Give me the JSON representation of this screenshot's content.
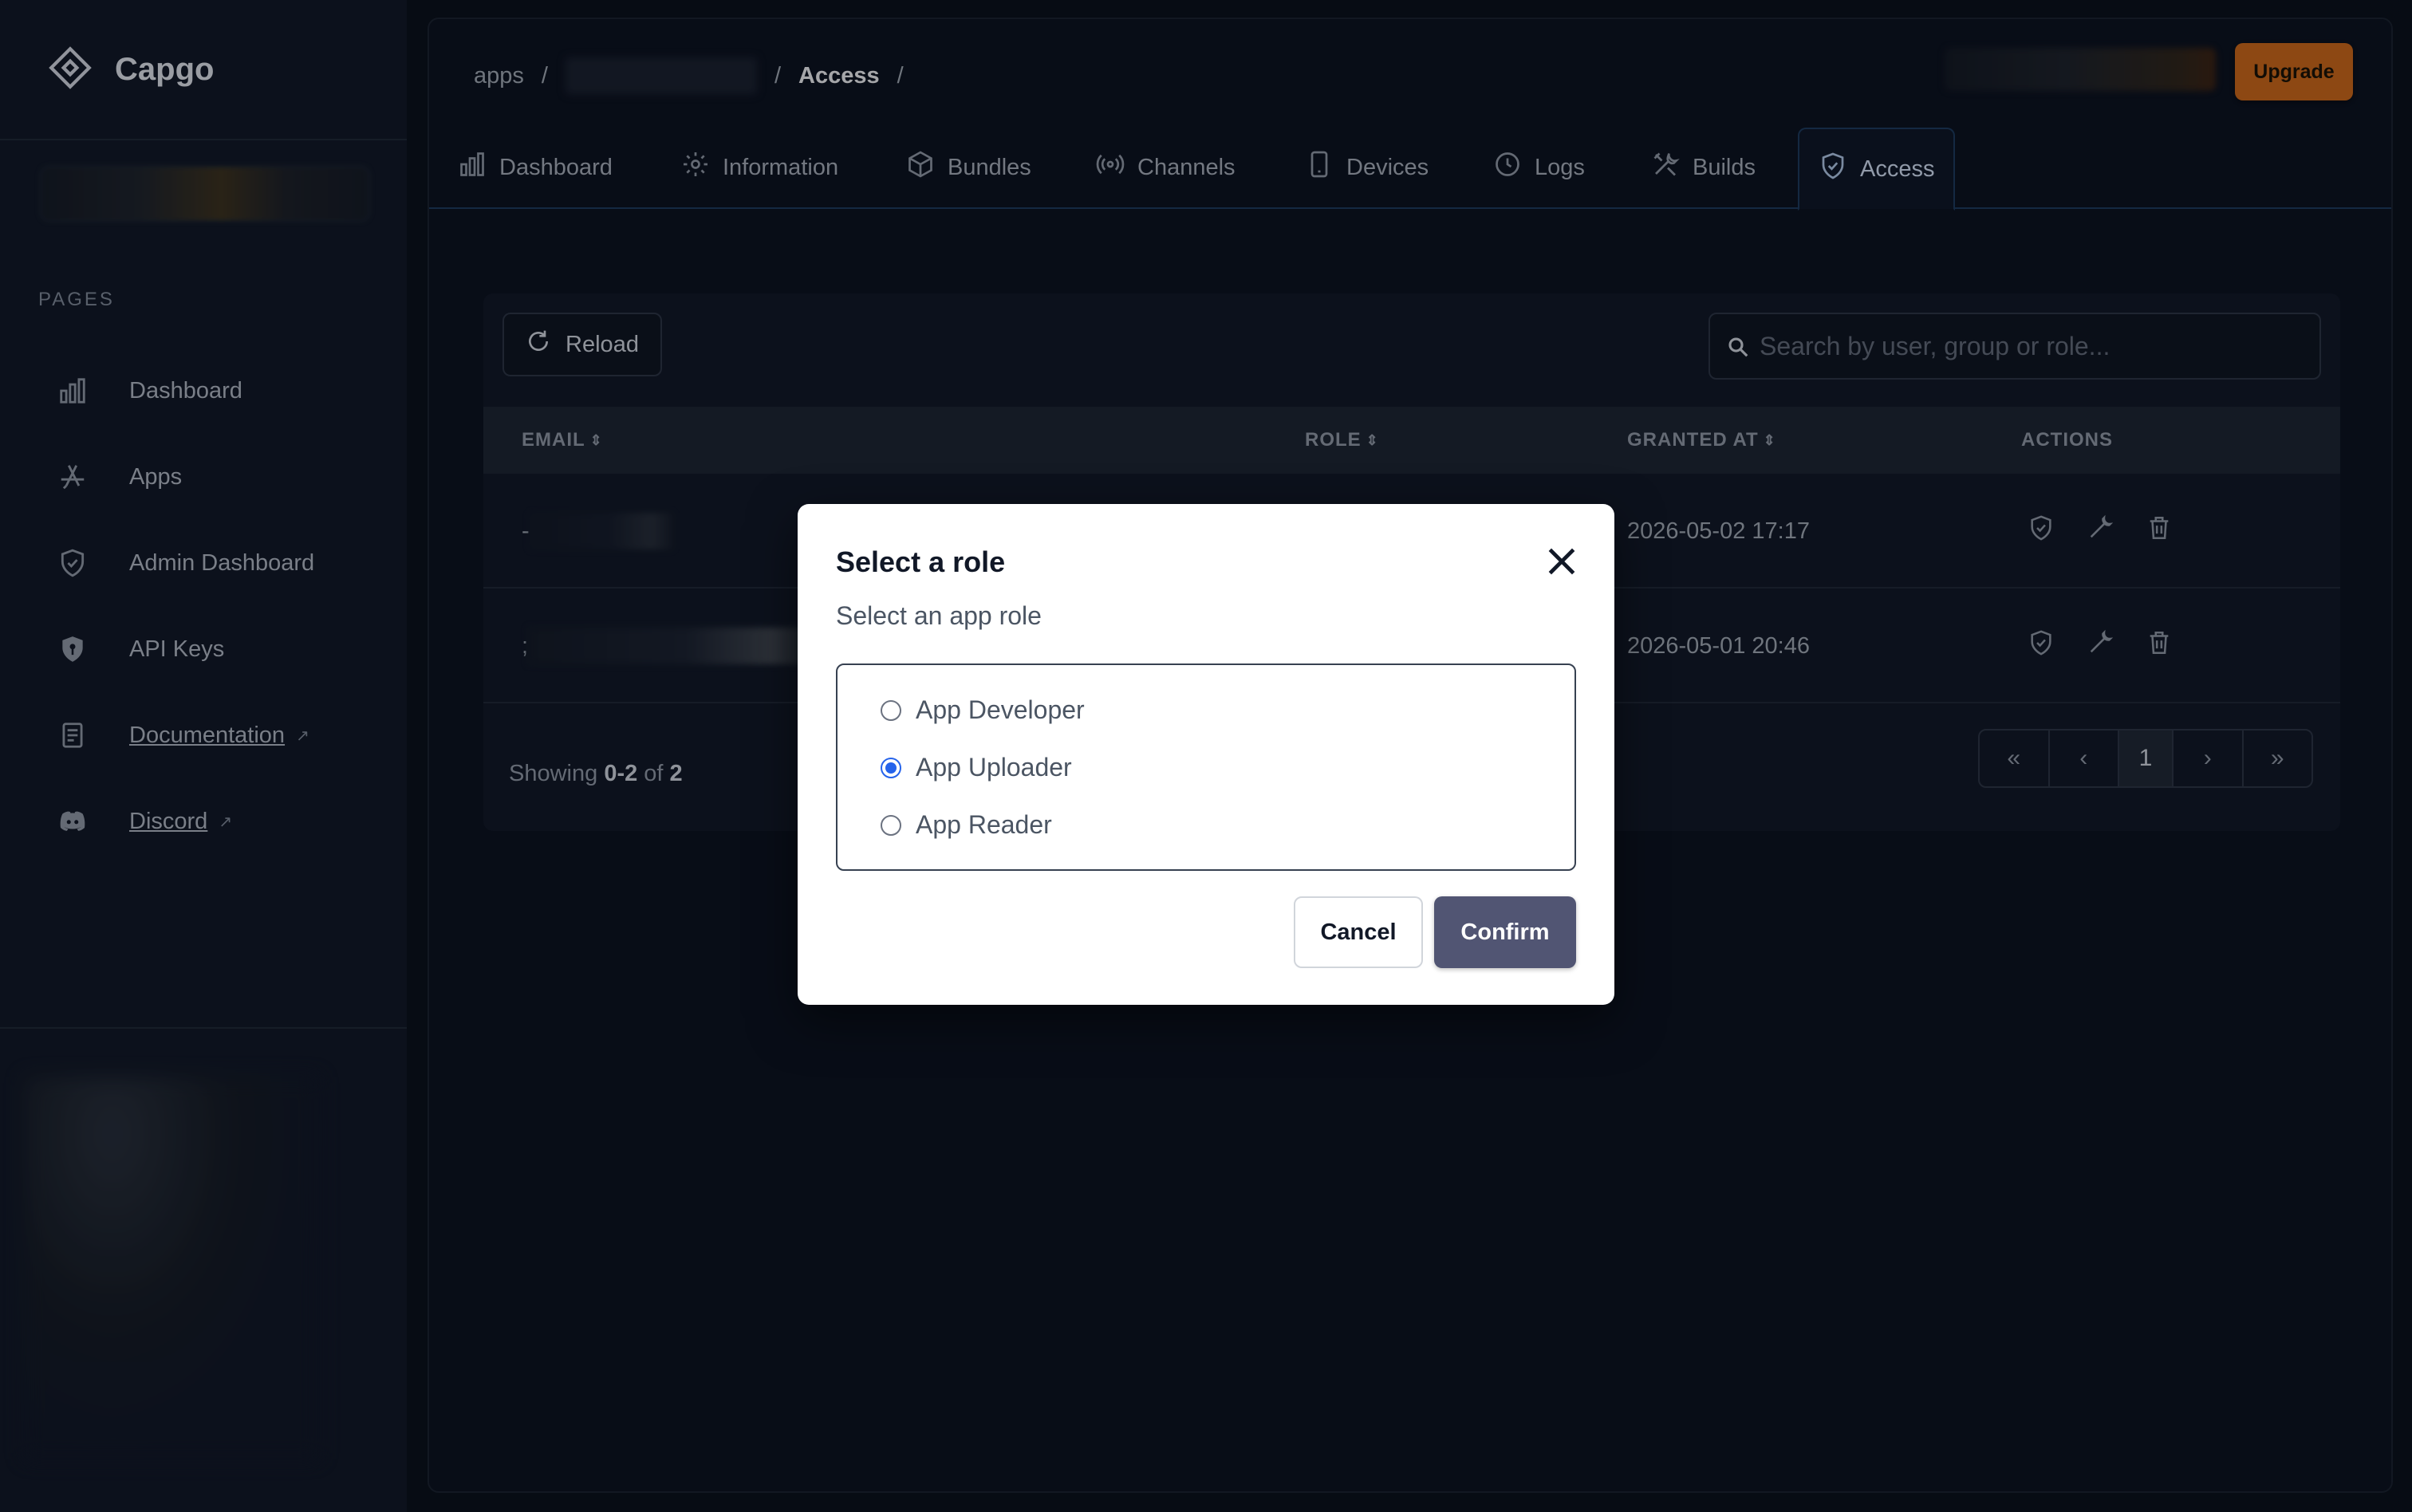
{
  "brand": {
    "name": "Capgo"
  },
  "sidebar": {
    "section_label": "PAGES",
    "items": [
      {
        "label": "Dashboard",
        "icon": "bar-chart-icon"
      },
      {
        "label": "Apps",
        "icon": "app-store-icon"
      },
      {
        "label": "Admin Dashboard",
        "icon": "shield-check-icon"
      },
      {
        "label": "API Keys",
        "icon": "shield-key-icon"
      },
      {
        "label": "Documentation",
        "icon": "document-icon",
        "external": true
      },
      {
        "label": "Discord",
        "icon": "discord-icon",
        "external": true
      }
    ]
  },
  "breadcrumb": {
    "root": "apps",
    "current": "Access",
    "sep": "/"
  },
  "header": {
    "upgrade_label": "Upgrade"
  },
  "tabs": [
    {
      "label": "Dashboard",
      "icon": "bar-chart-icon"
    },
    {
      "label": "Information",
      "icon": "gear-icon"
    },
    {
      "label": "Bundles",
      "icon": "cube-icon"
    },
    {
      "label": "Channels",
      "icon": "broadcast-icon"
    },
    {
      "label": "Devices",
      "icon": "phone-icon"
    },
    {
      "label": "Logs",
      "icon": "clock-icon"
    },
    {
      "label": "Builds",
      "icon": "tools-icon"
    },
    {
      "label": "Access",
      "icon": "shield-check-icon",
      "active": true
    }
  ],
  "table": {
    "reload_label": "Reload",
    "search_placeholder": "Search by user, group or role...",
    "columns": {
      "email": "EMAIL",
      "role": "ROLE",
      "granted_at": "GRANTED AT",
      "actions": "ACTIONS"
    },
    "rows": [
      {
        "email_prefix": "-",
        "granted_at": "2026-05-02 17:17"
      },
      {
        "email_prefix": ";",
        "granted_at": "2026-05-01 20:46"
      }
    ],
    "showing": {
      "prefix": "Showing",
      "range": "0-2",
      "of": "of",
      "total": "2"
    },
    "pagination": {
      "first": "«",
      "prev": "‹",
      "current": "1",
      "next": "›",
      "last": "»"
    }
  },
  "modal": {
    "title": "Select a role",
    "subtitle": "Select an app role",
    "options": [
      {
        "label": "App Developer",
        "selected": false
      },
      {
        "label": "App Uploader",
        "selected": true
      },
      {
        "label": "App Reader",
        "selected": false
      }
    ],
    "cancel_label": "Cancel",
    "confirm_label": "Confirm"
  },
  "colors": {
    "accent": "#c4651b",
    "confirm": "#515573",
    "radio": "#2563eb",
    "active_tab": "#1d3a5c"
  }
}
